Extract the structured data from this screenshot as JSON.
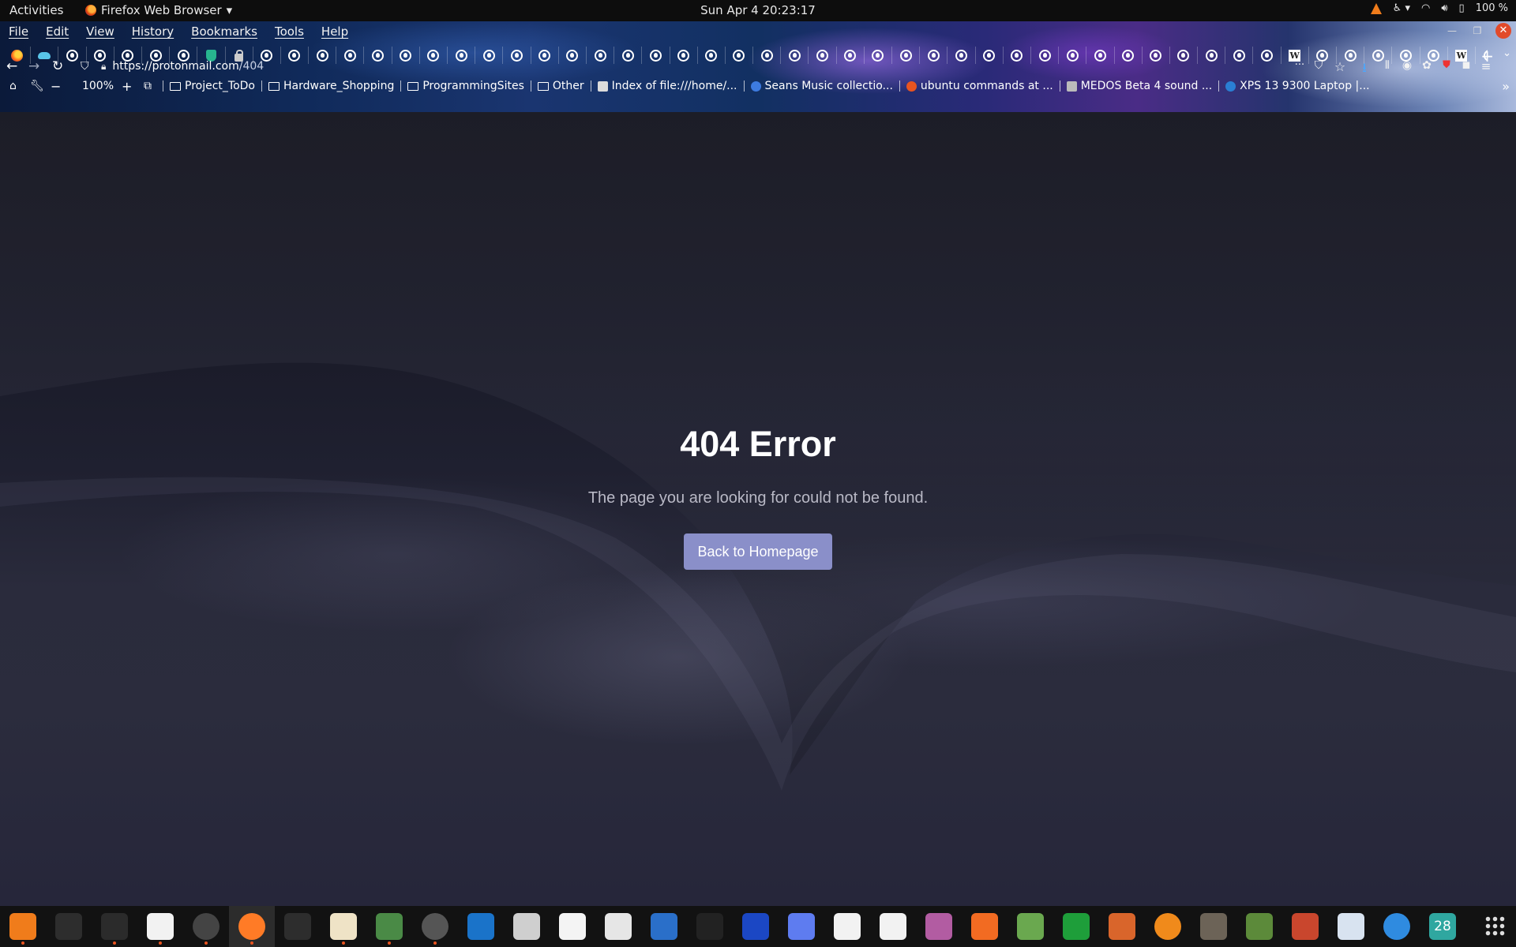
{
  "topbar": {
    "activities": "Activities",
    "app_name": "Firefox Web Browser",
    "clock": "Sun Apr 4  20:23:17",
    "battery": "100 %"
  },
  "menubar": {
    "items": [
      "File",
      "Edit",
      "View",
      "History",
      "Bookmarks",
      "Tools",
      "Help"
    ]
  },
  "tabs": {
    "icons": [
      "firefox-icon",
      "cloud-icon",
      "github-icon",
      "github-icon",
      "github-icon",
      "github-icon",
      "github-icon",
      "shield-icon",
      "lock-icon",
      "github-icon",
      "github-icon",
      "github-icon",
      "github-icon",
      "github-icon",
      "github-icon",
      "github-icon",
      "github-icon",
      "github-icon",
      "github-icon",
      "github-icon",
      "github-icon",
      "github-icon",
      "github-icon",
      "github-icon",
      "github-icon",
      "github-icon",
      "github-icon",
      "github-icon",
      "github-icon",
      "github-icon",
      "github-icon",
      "github-icon",
      "github-icon",
      "github-icon",
      "github-icon",
      "github-icon",
      "github-icon",
      "github-icon",
      "github-icon",
      "github-icon",
      "github-icon",
      "github-icon",
      "github-icon",
      "github-icon",
      "github-icon",
      "github-icon",
      "wikipedia-icon",
      "github-icon",
      "github-icon",
      "github-icon",
      "github-icon",
      "github-icon",
      "wikipedia-icon",
      "github-icon"
    ]
  },
  "navbar": {
    "url_host": "https://protonmail.com",
    "url_path": "/404",
    "zoom": "100%",
    "more": "···"
  },
  "bookmarks": {
    "items": [
      {
        "label": "Project_ToDo",
        "icon": "folder-icon"
      },
      {
        "label": "Hardware_Shopping",
        "icon": "folder-icon"
      },
      {
        "label": "ProgrammingSites",
        "icon": "folder-icon"
      },
      {
        "label": "Other",
        "icon": "folder-icon"
      },
      {
        "label": "Index of file:///home/...",
        "icon": "file-icon"
      },
      {
        "label": "Seans Music collectio...",
        "icon": "globe-icon"
      },
      {
        "label": "ubuntu commands at ...",
        "icon": "ubuntu-icon"
      },
      {
        "label": "MEDOS Beta 4 sound ...",
        "icon": "page-icon"
      },
      {
        "label": "XPS 13 9300 Laptop |...",
        "icon": "dell-icon"
      }
    ]
  },
  "page": {
    "title": "404 Error",
    "message": "The page you are looking for could not be found.",
    "button": "Back to Homepage"
  },
  "dock": {
    "apps": [
      {
        "name": "vlc",
        "color": "#f07c1b",
        "running": true
      },
      {
        "name": "terminal",
        "color": "#2d2d2d",
        "running": false
      },
      {
        "name": "system-monitor",
        "color": "#2b2b2b",
        "running": true
      },
      {
        "name": "text-editor",
        "color": "#f2f2f2",
        "running": true
      },
      {
        "name": "clocks",
        "color": "#444444",
        "running": true
      },
      {
        "name": "firefox",
        "color": "#ff7b26",
        "running": true
      },
      {
        "name": "calculator",
        "color": "#2d2d2d",
        "running": false
      },
      {
        "name": "files",
        "color": "#efe3c6",
        "running": true
      },
      {
        "name": "gnome-extensions",
        "color": "#4a8a46",
        "running": true
      },
      {
        "name": "settings",
        "color": "#555555",
        "running": true
      },
      {
        "name": "libreoffice-writer",
        "color": "#1a73c9",
        "running": false
      },
      {
        "name": "document-viewer",
        "color": "#cfcfcf",
        "running": false
      },
      {
        "name": "audio-editor",
        "color": "#f4f4f4",
        "running": false
      },
      {
        "name": "software-updater",
        "color": "#e6e6e6",
        "running": false
      },
      {
        "name": "virtualbox",
        "color": "#2a6fc9",
        "running": false
      },
      {
        "name": "inkscape",
        "color": "#222222",
        "running": false
      },
      {
        "name": "audacity",
        "color": "#1b47c4",
        "running": false
      },
      {
        "name": "screenshot",
        "color": "#5e7cf0",
        "running": false
      },
      {
        "name": "character-map",
        "color": "#f2f2f2",
        "running": false
      },
      {
        "name": "typora",
        "color": "#f2f2f2",
        "running": false
      },
      {
        "name": "tweaks",
        "color": "#b25ca2",
        "running": false
      },
      {
        "name": "ubuntu-software",
        "color": "#f26b22",
        "running": false
      },
      {
        "name": "image-viewer",
        "color": "#6aa84f",
        "running": false
      },
      {
        "name": "libreoffice-calc",
        "color": "#1e9e3a",
        "running": false
      },
      {
        "name": "libreoffice-impress",
        "color": "#d9652b",
        "running": false
      },
      {
        "name": "blender",
        "color": "#f08a1b",
        "running": false
      },
      {
        "name": "gimp",
        "color": "#6c6357",
        "running": false
      },
      {
        "name": "minecraft",
        "color": "#5c8a3a",
        "running": false
      },
      {
        "name": "game",
        "color": "#c9462d",
        "running": false
      },
      {
        "name": "deja-dup",
        "color": "#d8e3f0",
        "running": false
      },
      {
        "name": "help",
        "color": "#2f8be0",
        "running": false
      },
      {
        "name": "calendar",
        "color": "#2fa7a0",
        "running": false
      }
    ],
    "calendar_day": "28"
  }
}
